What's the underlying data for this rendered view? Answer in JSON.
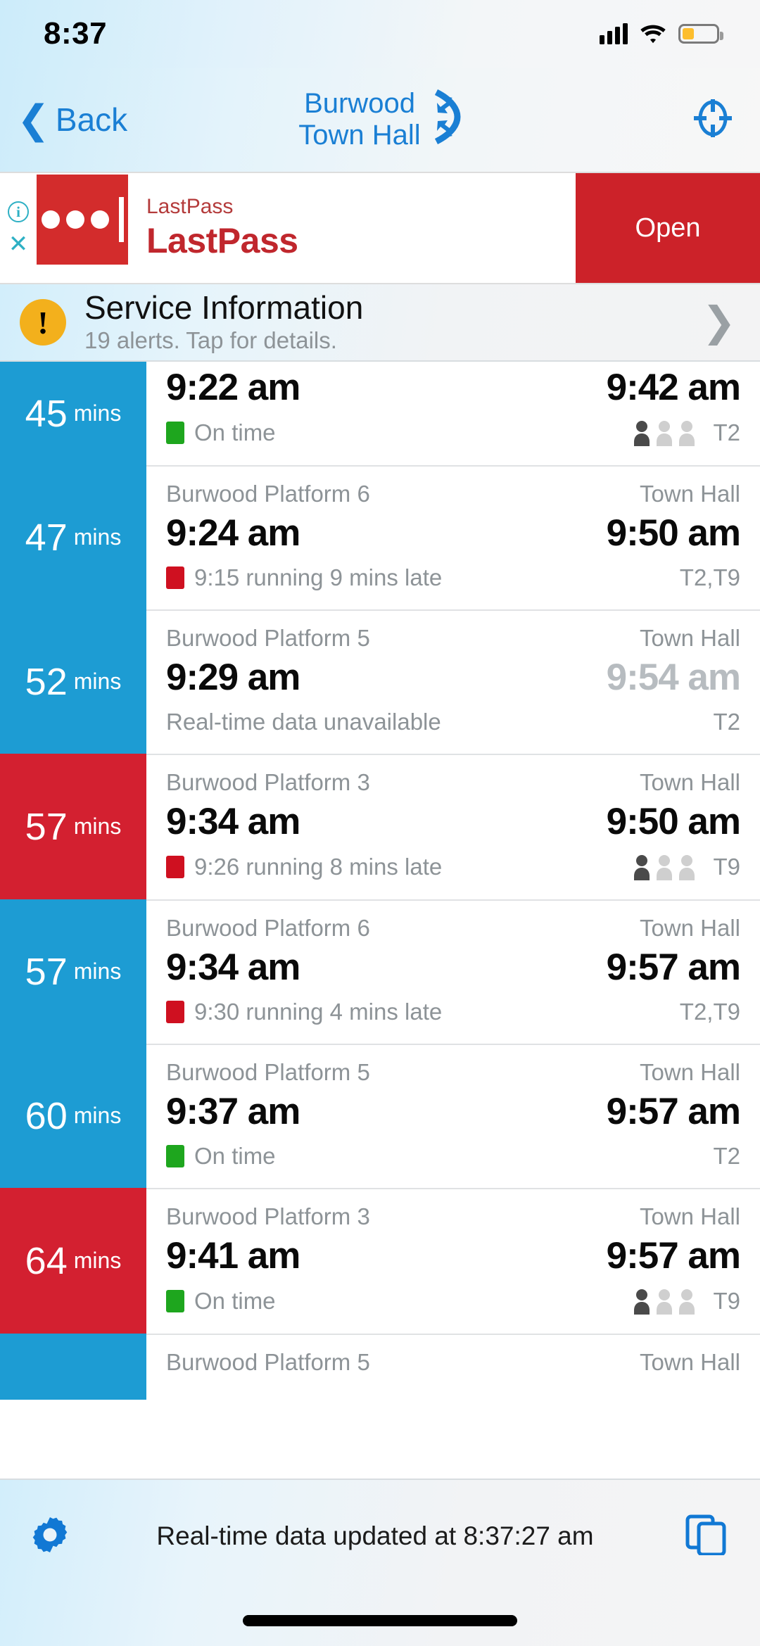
{
  "status_bar": {
    "time": "8:37",
    "signal_icon": "cellular-bars-icon",
    "wifi_icon": "wifi-icon",
    "battery_icon": "battery-low-icon"
  },
  "nav_bar": {
    "back_label": "Back",
    "back_icon": "chevron-left-icon",
    "origin": "Burwood",
    "destination": "Town Hall",
    "swap_icon": "swap-direction-icon",
    "locate_icon": "locate-crosshair-icon"
  },
  "ad_banner": {
    "info_icon": "info-circle-icon",
    "close_icon": "close-x-icon",
    "logo_icon": "lastpass-logo-icon",
    "advertiser": "LastPass",
    "title": "LastPass",
    "cta_label": "Open",
    "brand_color": "#cc2229"
  },
  "service_info": {
    "alert_icon": "warning-exclamation-icon",
    "title": "Service Information",
    "subtitle": "19 alerts. Tap for details.",
    "chevron_icon": "chevron-right-icon",
    "badge_color": "#f3b01c"
  },
  "departures": {
    "columns": [
      "countdown",
      "from",
      "to",
      "departure",
      "arrival",
      "status",
      "lines"
    ],
    "rows": [
      {
        "countdown": "45",
        "countdown_unit": "mins",
        "countdown_color": "blue",
        "from": "",
        "to": "",
        "departure": "9:22 am",
        "arrival": "9:42 am",
        "arrival_dim": false,
        "status": "On time",
        "status_color": "green",
        "lines": "T2",
        "occupancy": true,
        "clipped": true
      },
      {
        "countdown": "47",
        "countdown_unit": "mins",
        "countdown_color": "blue",
        "from": "Burwood Platform 6",
        "to": "Town Hall",
        "departure": "9:24 am",
        "arrival": "9:50 am",
        "arrival_dim": false,
        "status": "9:15 running 9 mins late",
        "status_color": "red",
        "lines": "T2,T9",
        "occupancy": false,
        "clipped": false
      },
      {
        "countdown": "52",
        "countdown_unit": "mins",
        "countdown_color": "blue",
        "from": "Burwood Platform 5",
        "to": "Town Hall",
        "departure": "9:29 am",
        "arrival": "9:54 am",
        "arrival_dim": true,
        "status": "Real-time data unavailable",
        "status_color": "none",
        "lines": "T2",
        "occupancy": false,
        "clipped": false
      },
      {
        "countdown": "57",
        "countdown_unit": "mins",
        "countdown_color": "red",
        "from": "Burwood Platform 3",
        "to": "Town Hall",
        "departure": "9:34 am",
        "arrival": "9:50 am",
        "arrival_dim": false,
        "status": "9:26 running 8 mins late",
        "status_color": "red",
        "lines": "T9",
        "occupancy": true,
        "clipped": false
      },
      {
        "countdown": "57",
        "countdown_unit": "mins",
        "countdown_color": "blue",
        "from": "Burwood Platform 6",
        "to": "Town Hall",
        "departure": "9:34 am",
        "arrival": "9:57 am",
        "arrival_dim": false,
        "status": "9:30 running 4 mins late",
        "status_color": "red",
        "lines": "T2,T9",
        "occupancy": false,
        "clipped": false
      },
      {
        "countdown": "60",
        "countdown_unit": "mins",
        "countdown_color": "blue",
        "from": "Burwood Platform 5",
        "to": "Town Hall",
        "departure": "9:37 am",
        "arrival": "9:57 am",
        "arrival_dim": false,
        "status": "On time",
        "status_color": "green",
        "lines": "T2",
        "occupancy": false,
        "clipped": false
      },
      {
        "countdown": "64",
        "countdown_unit": "mins",
        "countdown_color": "red",
        "from": "Burwood Platform 3",
        "to": "Town Hall",
        "departure": "9:41 am",
        "arrival": "9:57 am",
        "arrival_dim": false,
        "status": "On time",
        "status_color": "green",
        "lines": "T9",
        "occupancy": true,
        "clipped": false
      },
      {
        "countdown": "",
        "countdown_unit": "",
        "countdown_color": "blue",
        "from": "Burwood Platform 5",
        "to": "Town Hall",
        "departure": "",
        "arrival": "",
        "arrival_dim": false,
        "status": "",
        "status_color": "none",
        "lines": "",
        "occupancy": false,
        "clipped": false
      }
    ]
  },
  "bottom_bar": {
    "settings_icon": "gear-icon",
    "update_text": "Real-time data updated at 8:37:27 am",
    "copy_icon": "duplicate-windows-icon"
  },
  "colors": {
    "accent_blue": "#1d9cd3",
    "alert_red": "#d32030",
    "on_time_green": "#1ea61e",
    "late_red": "#cf1020",
    "link_blue": "#1a7fd4"
  }
}
